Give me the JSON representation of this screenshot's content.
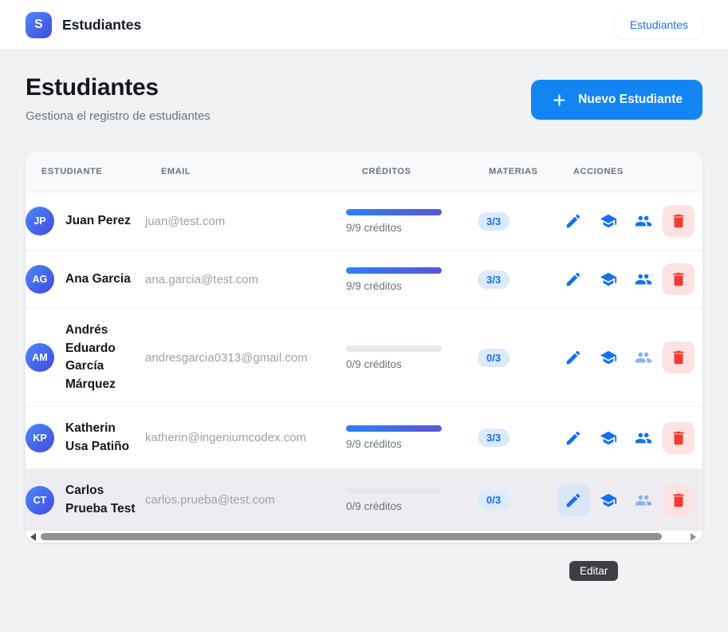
{
  "topbar": {
    "logo_letter": "S",
    "app_title": "Estudiantes",
    "nav_link": "Estudiantes"
  },
  "page": {
    "title": "Estudiantes",
    "subtitle": "Gestiona el registro de estudiantes",
    "new_student_button": "Nuevo Estudiante"
  },
  "table": {
    "columns": [
      "Estudiante",
      "Email",
      "Créditos",
      "Materias",
      "Acciones"
    ],
    "rows": [
      {
        "initials": "JP",
        "name": "Juan Perez",
        "email": "juan@test.com",
        "credits": "9/9 créditos",
        "credits_pct": 100,
        "materias": "3/3",
        "group_active": true,
        "highlighted": false,
        "edit_active": false
      },
      {
        "initials": "AG",
        "name": "Ana Garcia",
        "email": "ana.garcia@test.com",
        "credits": "9/9 créditos",
        "credits_pct": 100,
        "materias": "3/3",
        "group_active": true,
        "highlighted": false,
        "edit_active": false
      },
      {
        "initials": "AM",
        "name": "Andrés Eduardo García Márquez",
        "email": "andresgarcia0313@gmail.com",
        "credits": "0/9 créditos",
        "credits_pct": 0,
        "materias": "0/3",
        "group_active": false,
        "highlighted": false,
        "edit_active": false
      },
      {
        "initials": "KP",
        "name": "Katherin Usa Patiño",
        "email": "katherin@ingeniumcodex.com",
        "credits": "9/9 créditos",
        "credits_pct": 100,
        "materias": "3/3",
        "group_active": true,
        "highlighted": false,
        "edit_active": false
      },
      {
        "initials": "CT",
        "name": "Carlos Prueba Test",
        "email": "carlos.prueba@test.com",
        "credits": "0/9 créditos",
        "credits_pct": 0,
        "materias": "0/3",
        "group_active": false,
        "highlighted": true,
        "edit_active": true
      }
    ]
  },
  "tooltip": {
    "label": "Editar"
  },
  "icons": {
    "logo": "app-logo-s",
    "add": "plus-icon",
    "edit": "pencil-icon",
    "subjects": "graduation-cap-icon",
    "groups": "people-icon",
    "delete": "trash-icon",
    "scroll_left": "scroll-left-arrow-icon",
    "scroll_right": "scroll-right-arrow-icon"
  },
  "colors": {
    "accent_blue": "#1285f2",
    "link_blue": "#1a73e8",
    "badge_bg": "#dbeafe",
    "badge_text": "#146eec",
    "danger_red": "#f43b30",
    "danger_bg": "#fce2e2",
    "progress_gradient_start": "#2b80f6",
    "progress_gradient_end": "#5a55d6",
    "avatar_gradient_start": "#4b8af7",
    "avatar_gradient_end": "#4348e0",
    "page_bg": "#f1f2f4",
    "tooltip_bg": "#3e3f44"
  }
}
